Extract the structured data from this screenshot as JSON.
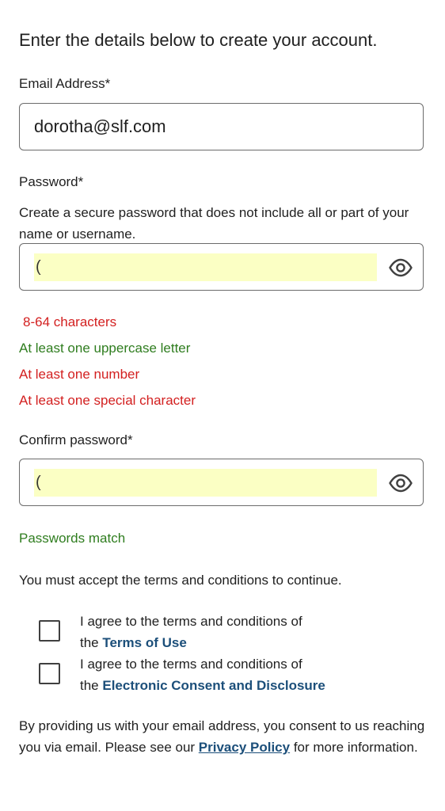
{
  "intro": "Enter the details below to create your account.",
  "email": {
    "label": "Email Address*",
    "value": "dorotha@slf.com"
  },
  "password": {
    "label": "Password*",
    "help": "Create a secure password that does not include all or part of your name or username.",
    "value": "(",
    "autofill_color": "#fbffc4"
  },
  "rules": [
    {
      "text": "8-64 characters",
      "status": "unmet"
    },
    {
      "text": "At least one uppercase letter",
      "status": "met"
    },
    {
      "text": "At least one number",
      "status": "unmet"
    },
    {
      "text": "At least one special character",
      "status": "unmet"
    }
  ],
  "confirm": {
    "label": "Confirm password*",
    "value": "(",
    "match_text": "Passwords match"
  },
  "terms": {
    "note": "You must accept the terms and conditions to continue.",
    "items": [
      {
        "line1": "I agree to the terms and conditions of",
        "prefix": "the ",
        "link": "Terms of Use",
        "checked": false
      },
      {
        "line1": "I agree to the terms and conditions of",
        "prefix": "the ",
        "link": "Electronic Consent and Disclosure",
        "checked": false
      }
    ]
  },
  "consent": {
    "before": "By providing us with your email address, you consent to us reaching you via email. Please see our ",
    "link": "Privacy Policy",
    "after": " for more information."
  },
  "icons": {
    "show_password": "eye-icon"
  },
  "colors": {
    "error": "#d32020",
    "success": "#2f7d1f",
    "link": "#1c4f7a"
  }
}
